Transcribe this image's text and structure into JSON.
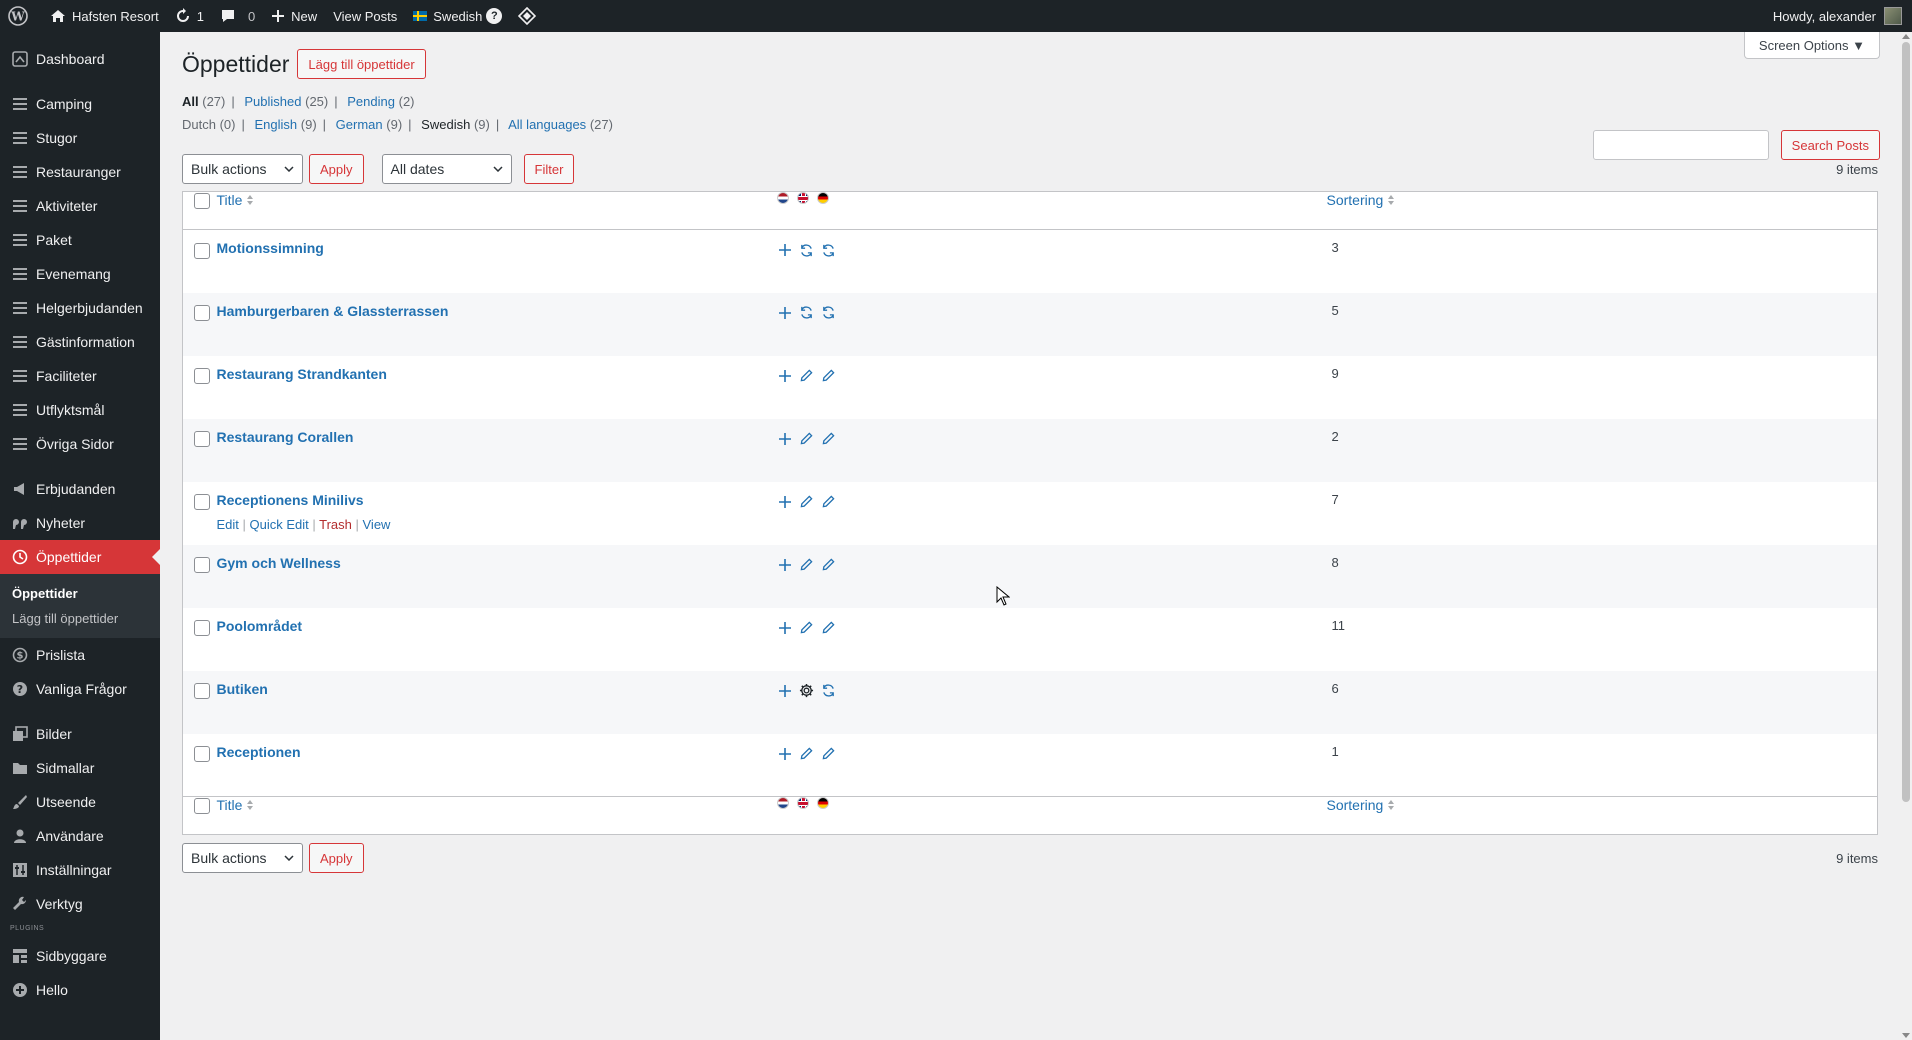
{
  "adminbar": {
    "site_name": "Hafsten Resort",
    "updates_count": "1",
    "comments_count": "0",
    "new_label": "New",
    "view_posts_label": "View Posts",
    "language_label": "Swedish",
    "help_glyph": "?",
    "howdy": "Howdy, alexander"
  },
  "sidebar": {
    "items_top": [
      {
        "label": "Dashboard",
        "icon": "dashboard-icon"
      }
    ],
    "items_group1": [
      {
        "label": "Camping"
      },
      {
        "label": "Stugor"
      },
      {
        "label": "Restauranger"
      },
      {
        "label": "Aktiviteter"
      },
      {
        "label": "Paket"
      },
      {
        "label": "Evenemang"
      },
      {
        "label": "Helgerbjudanden"
      },
      {
        "label": "Gästinformation"
      },
      {
        "label": "Faciliteter"
      },
      {
        "label": "Utflyktsmål"
      },
      {
        "label": "Övriga Sidor"
      }
    ],
    "erbjudanden": "Erbjudanden",
    "nyheter": "Nyheter",
    "oppettider": "Öppettider",
    "submenu": {
      "current": "Öppettider",
      "add": "Lägg till öppettider"
    },
    "prislista": "Prislista",
    "faq": "Vanliga Frågor",
    "bilder": "Bilder",
    "sidmallar": "Sidmallar",
    "utseende": "Utseende",
    "anvandare": "Användare",
    "installningar": "Inställningar",
    "verktyg": "Verktyg",
    "plugins_label": "PLUGINS",
    "sidbyggare": "Sidbyggare",
    "hello": "Hello"
  },
  "screen_options": "Screen Options ▼",
  "page": {
    "title": "Öppettider",
    "add_button": "Lägg till öppettider"
  },
  "status_filters": {
    "all": "All",
    "all_count": "(27)",
    "published": "Published",
    "published_count": "(25)",
    "pending": "Pending",
    "pending_count": "(2)"
  },
  "lang_filters": {
    "dutch": "Dutch",
    "dutch_count": "(0)",
    "english": "English",
    "english_count": "(9)",
    "german": "German",
    "german_count": "(9)",
    "swedish": "Swedish",
    "swedish_count": "(9)",
    "all_languages": "All languages",
    "all_languages_count": "(27)"
  },
  "search": {
    "button": "Search Posts",
    "value": ""
  },
  "tablenav": {
    "bulk_actions": "Bulk actions",
    "apply": "Apply",
    "all_dates": "All dates",
    "filter": "Filter",
    "items_count": "9 items"
  },
  "table": {
    "col_title": "Title",
    "col_sort": "Sortering",
    "rows": [
      {
        "title": "Motionssimning",
        "sort": "3",
        "icons": [
          "plus",
          "sync",
          "sync"
        ]
      },
      {
        "title": "Hamburgerbaren & Glassterrassen",
        "sort": "5",
        "icons": [
          "plus",
          "sync",
          "sync"
        ]
      },
      {
        "title": "Restaurang Strandkanten",
        "sort": "9",
        "icons": [
          "plus",
          "pencil",
          "pencil"
        ]
      },
      {
        "title": "Restaurang Corallen",
        "sort": "2",
        "icons": [
          "plus",
          "pencil",
          "pencil"
        ]
      },
      {
        "title": "Receptionens Minilivs",
        "sort": "7",
        "icons": [
          "plus",
          "pencil",
          "pencil"
        ]
      },
      {
        "title": "Gym och Wellness",
        "sort": "8",
        "icons": [
          "plus",
          "pencil",
          "pencil"
        ]
      },
      {
        "title": "Poolområdet",
        "sort": "11",
        "icons": [
          "plus",
          "pencil",
          "pencil"
        ]
      },
      {
        "title": "Butiken",
        "sort": "6",
        "icons": [
          "plus",
          "gear",
          "sync"
        ]
      },
      {
        "title": "Receptionen",
        "sort": "1",
        "icons": [
          "plus",
          "pencil",
          "pencil"
        ]
      }
    ],
    "row_actions": {
      "edit": "Edit",
      "quick_edit": "Quick Edit",
      "trash": "Trash",
      "view": "View"
    }
  },
  "colors": {
    "accent": "#d63638",
    "link": "#2271b1",
    "admin_bg": "#1d2327"
  }
}
